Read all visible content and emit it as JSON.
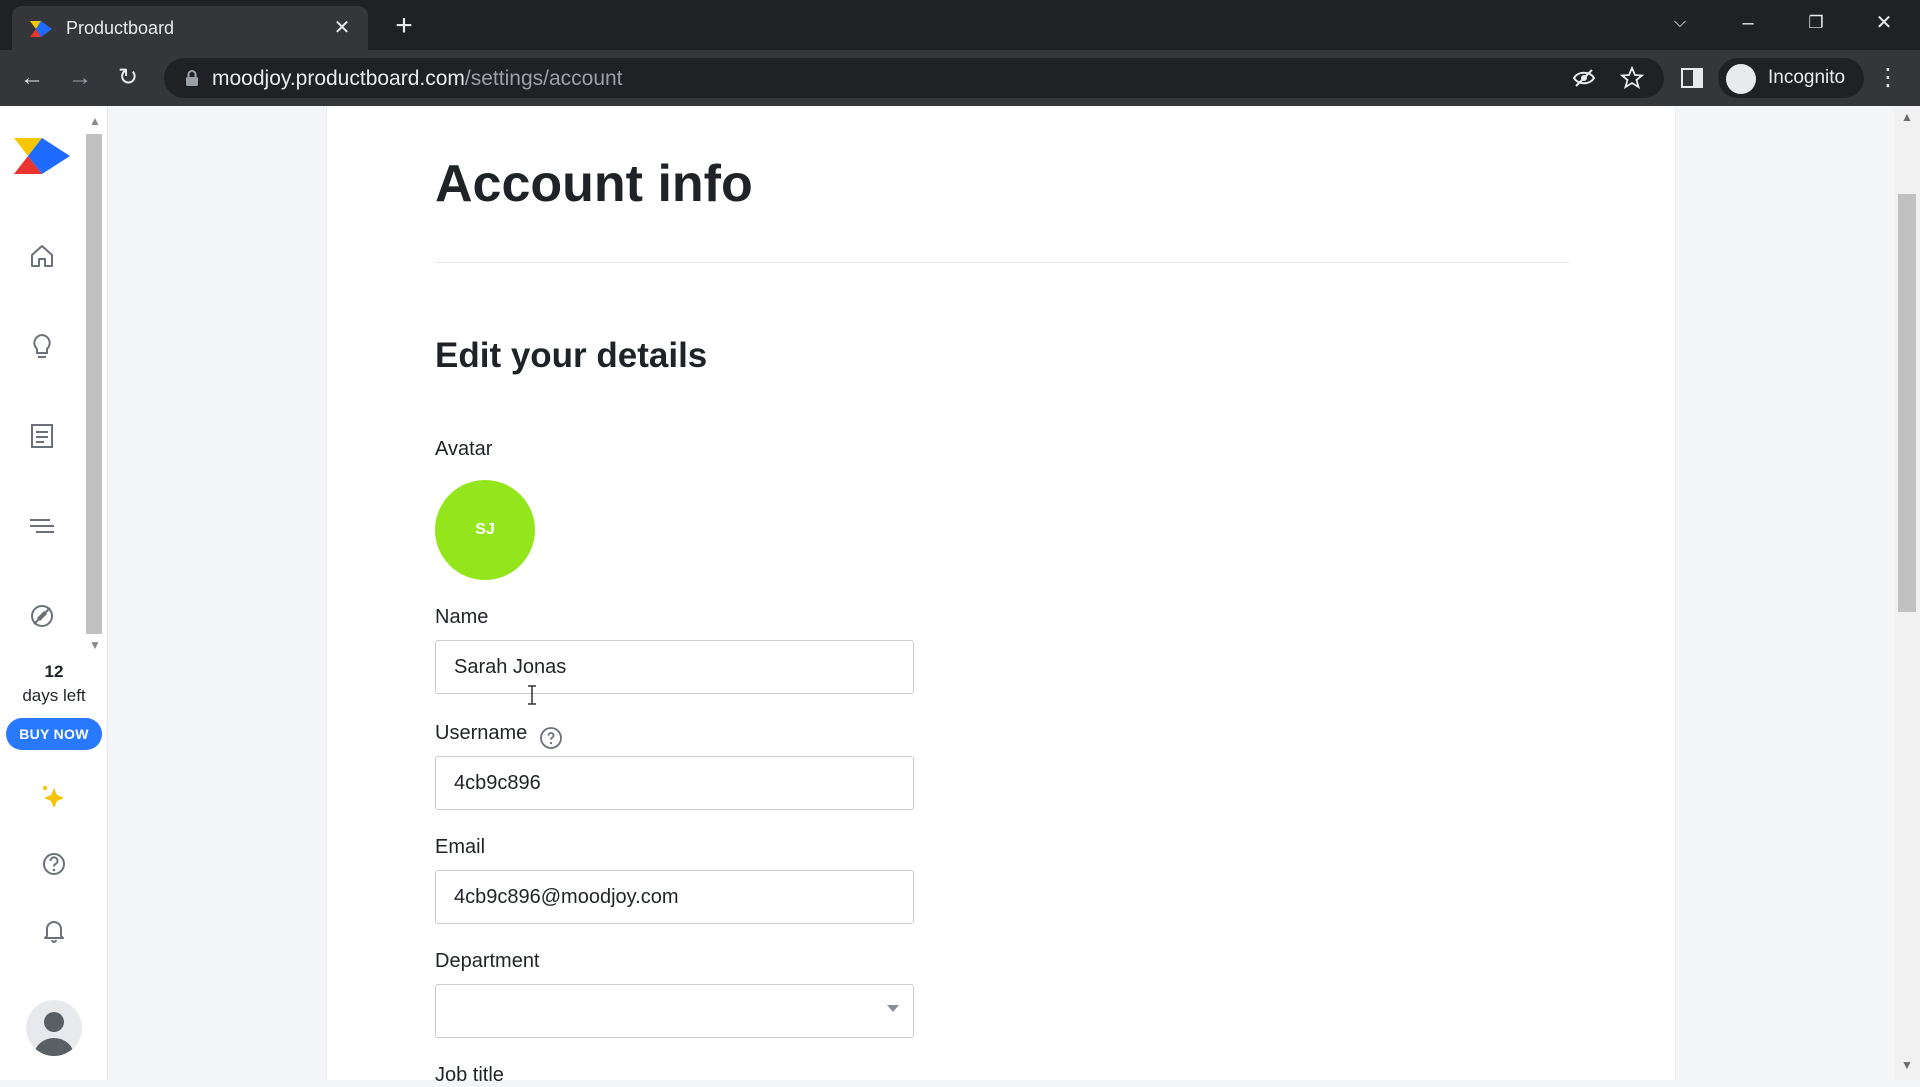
{
  "browser": {
    "tab_title": "Productboard",
    "url_domain": "moodjoy.productboard.com",
    "url_path": "/settings/account",
    "profile_label": "Incognito"
  },
  "sidebar": {
    "icons": [
      "home-icon",
      "lightbulb-icon",
      "notes-icon",
      "roadmap-icon",
      "portal-icon"
    ],
    "trial_days": "12",
    "trial_label": "days left",
    "buy_now": "BUY NOW",
    "bottom_icons": [
      "sparkle-icon",
      "help-icon",
      "bell-icon"
    ]
  },
  "main": {
    "title": "Account info",
    "section_title": "Edit your details",
    "avatar_label": "Avatar",
    "avatar_initials": "SJ",
    "name_label": "Name",
    "name_value": "Sarah Jonas",
    "username_label": "Username",
    "username_value": "4cb9c896",
    "email_label": "Email",
    "email_value": "4cb9c896@moodjoy.com",
    "department_label": "Department",
    "department_value": "",
    "job_title_label": "Job title"
  },
  "colors": {
    "avatar_bg": "#93e51c",
    "buy_now": "#2979ff",
    "chrome_dark": "#202124",
    "chrome_toolbar": "#35363a"
  }
}
